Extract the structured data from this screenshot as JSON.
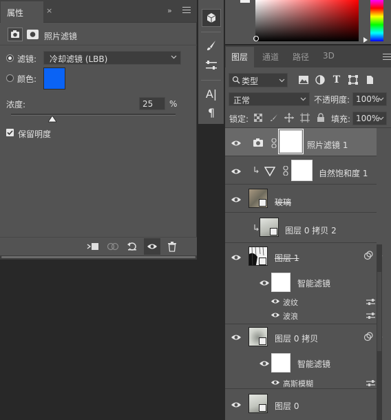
{
  "properties": {
    "tab_label": "属性",
    "tab_close": "×",
    "collapse": "»",
    "title": "照片滤镜",
    "filter_radio_label": "滤镜:",
    "filter_value": "冷却滤镜 (LBB)",
    "color_radio_label": "颜色:",
    "color_value": "#0a63f5",
    "density_label": "浓度:",
    "density_value": "25",
    "density_unit": "%",
    "density_fraction": 0.25,
    "preserve_label": "保留明度",
    "preserve_checked": true
  },
  "layers_panel": {
    "tabs": [
      "图层",
      "通道",
      "路径",
      "3D"
    ],
    "active_tab": "图层",
    "kind_label": "类型",
    "blend_mode": "正常",
    "opacity_label": "不透明度:",
    "opacity_value": "100%",
    "lock_label": "锁定:",
    "fill_label": "填充:",
    "fill_value": "100%",
    "layers": [
      {
        "name": "照片滤镜",
        "suffix": "1",
        "type": "adjustment",
        "selected": true
      },
      {
        "name": "自然饱和度",
        "suffix": "1",
        "type": "adjustment",
        "clipped": true
      },
      {
        "name": "玻璃",
        "type": "smart-object",
        "strike": true
      },
      {
        "name": "图层 0 拷贝 2",
        "type": "smart-object",
        "clipped": true
      },
      {
        "name": "图层 1",
        "type": "smart-object",
        "strike": true,
        "smart_filters_label": "智能滤镜",
        "filters": [
          "波纹",
          "波浪"
        ]
      },
      {
        "name": "图层 0 拷贝",
        "type": "smart-object",
        "smart_filters_label": "智能滤镜",
        "filters": [
          "高斯模糊"
        ]
      },
      {
        "name": "图层 0",
        "type": "smart-object"
      }
    ]
  },
  "tools": {
    "text_tool_glyph": "A|",
    "paragraph_glyph": "¶"
  }
}
